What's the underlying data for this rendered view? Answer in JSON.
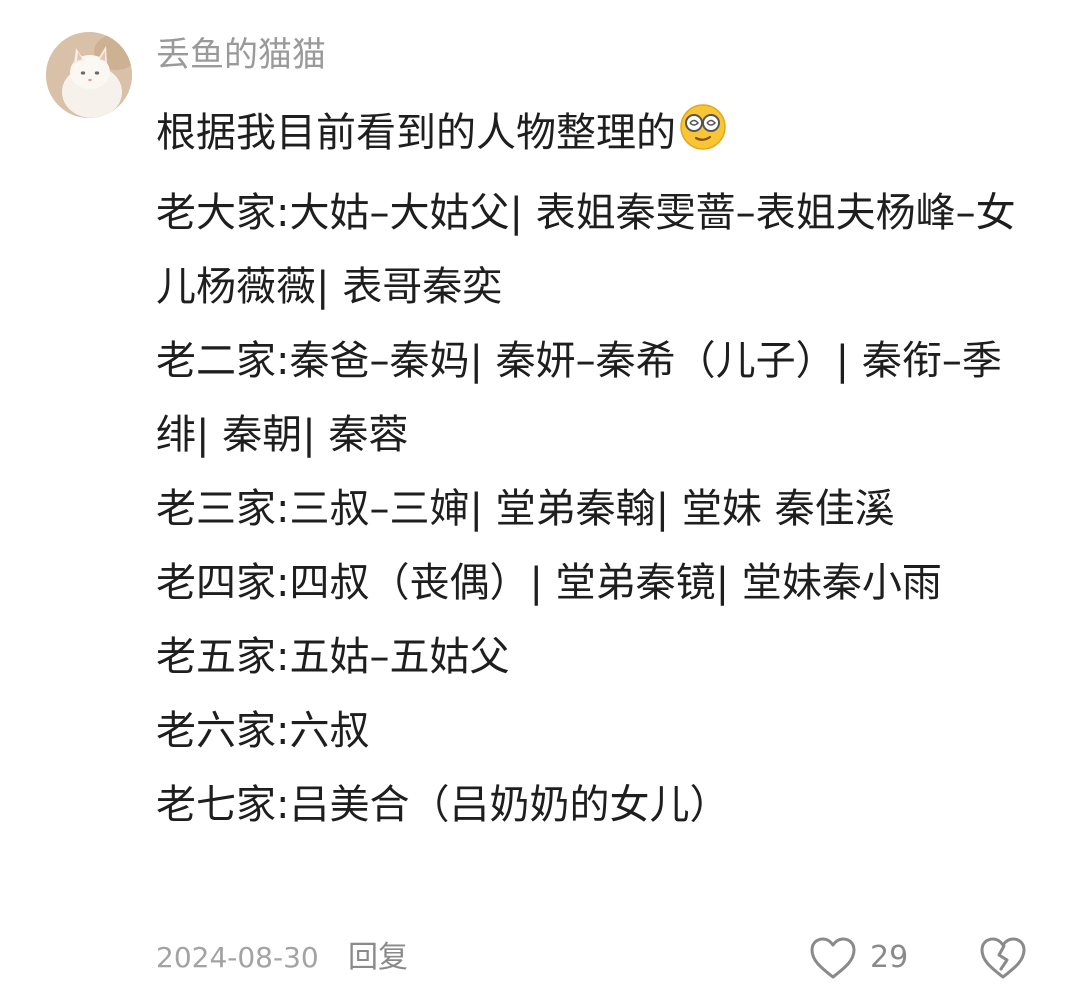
{
  "comment": {
    "avatar_icon": "white-cat-avatar-icon",
    "username": "丢鱼的猫猫",
    "intro": "根据我目前看到的人物整理的",
    "intro_emoji": "dizzy-glasses-emoji-icon",
    "lines": [
      "老大家:大姑–大姑父|  表姐秦雯蔷–表姐夫杨峰–女儿杨薇薇|  表哥秦奕",
      "老二家:秦爸–秦妈|  秦妍–秦希（儿子）|  秦衔–季绯|  秦朝|  秦蓉",
      "老三家:三叔–三婶|  堂弟秦翰|  堂妹 秦佳溪",
      "老四家:四叔（丧偶）|  堂弟秦镜|  堂妹秦小雨",
      "老五家:五姑–五姑父",
      "老六家:六叔",
      "老七家:吕美合（吕奶奶的女儿）"
    ],
    "date": "2024-08-30",
    "reply_label": "回复",
    "like_icon": "heart-outline-icon",
    "like_count": "29",
    "dislike_icon": "broken-heart-icon",
    "colors": {
      "text": "#1e1e1e",
      "muted": "#9a9a9a",
      "icon": "#8a8a8a"
    }
  }
}
